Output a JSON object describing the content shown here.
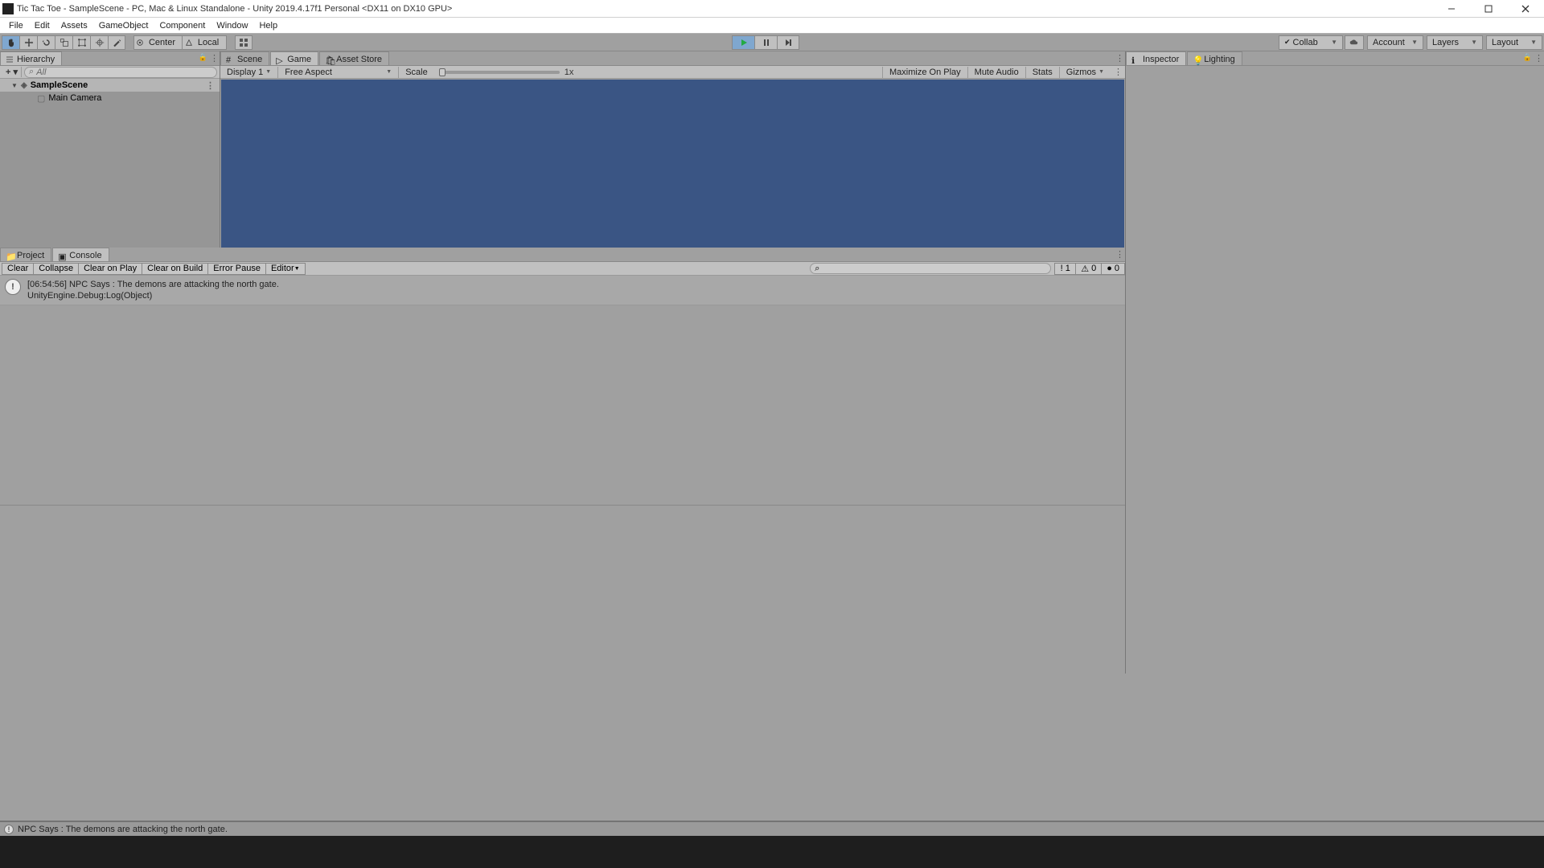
{
  "window": {
    "title": "Tic Tac Toe - SampleScene - PC, Mac & Linux Standalone - Unity 2019.4.17f1 Personal <DX11 on DX10 GPU>"
  },
  "menu": {
    "file": "File",
    "edit": "Edit",
    "assets": "Assets",
    "gameobject": "GameObject",
    "component": "Component",
    "window": "Window",
    "help": "Help"
  },
  "toolbar": {
    "center": "Center",
    "local": "Local",
    "collab": "Collab",
    "account": "Account",
    "layers": "Layers",
    "layout": "Layout"
  },
  "hierarchy": {
    "tab": "Hierarchy",
    "searchPlaceholder": "All",
    "scene": "SampleScene",
    "obj1": "Main Camera"
  },
  "tabs": {
    "scene": "Scene",
    "game": "Game",
    "asset": "Asset Store",
    "inspector": "Inspector",
    "lighting": "Lighting",
    "project": "Project",
    "console": "Console"
  },
  "game": {
    "display": "Display 1",
    "aspect": "Free Aspect",
    "scale": "Scale",
    "zoom": "1x",
    "maximize": "Maximize On Play",
    "mute": "Mute Audio",
    "stats": "Stats",
    "gizmos": "Gizmos"
  },
  "console": {
    "clear": "Clear",
    "collapse": "Collapse",
    "clearplay": "Clear on Play",
    "clearbuild": "Clear on Build",
    "errpause": "Error Pause",
    "editor": "Editor",
    "infoCount": "1",
    "warnCount": "0",
    "errCount": "0",
    "log1_line1": "[06:54:56] NPC Says : The demons are attacking the north gate.",
    "log1_line2": "UnityEngine.Debug:Log(Object)"
  },
  "status": {
    "text": "NPC Says : The demons are attacking the north gate."
  }
}
